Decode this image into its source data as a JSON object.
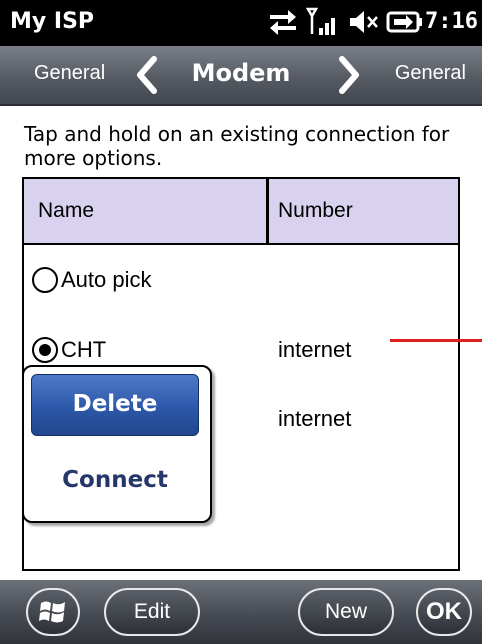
{
  "status_bar": {
    "app_title": "My ISP",
    "time": "7:16",
    "icons": [
      "sync-arrows-icon",
      "signal-strength-icon",
      "volume-muted-icon",
      "battery-charging-icon"
    ]
  },
  "nav": {
    "prev_label": "General",
    "title": "Modem",
    "next_label": "General"
  },
  "instructions": "Tap and hold on an existing connection for more options.",
  "list": {
    "columns": [
      "Name",
      "Number"
    ],
    "rows": [
      {
        "name": "Auto pick",
        "number": "",
        "selected": false
      },
      {
        "name": "CHT",
        "number": "internet",
        "selected": true
      },
      {
        "name": "",
        "number": "internet",
        "selected": false
      }
    ]
  },
  "context_menu": {
    "items": [
      "Delete",
      "Connect"
    ],
    "highlighted": "Delete"
  },
  "bottom_bar": {
    "edit_label": "Edit",
    "new_label": "New",
    "ok_label": "OK"
  },
  "colors": {
    "header_bg": "#d9d2ef",
    "menu_highlight": "#2b55a6",
    "marker": "#e02020"
  }
}
